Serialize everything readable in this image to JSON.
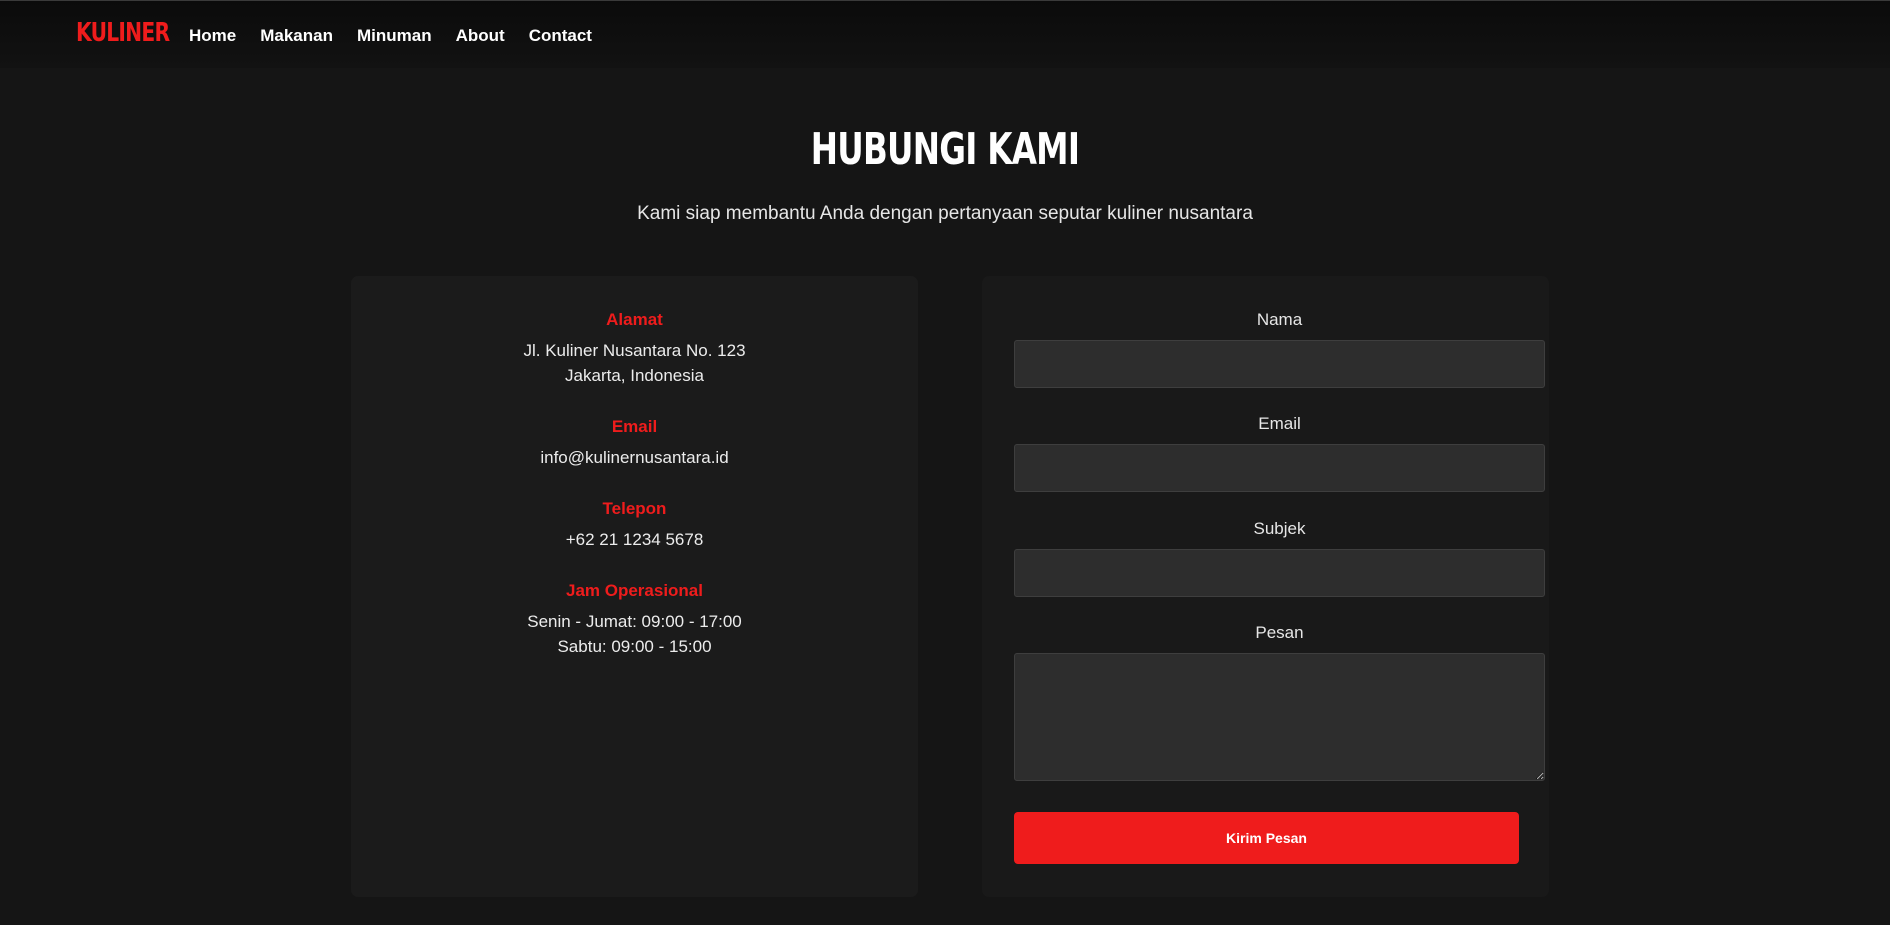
{
  "brand": {
    "logo": "KULINER",
    "accent_color": "#ef1c1c"
  },
  "nav": {
    "items": [
      "Home",
      "Makanan",
      "Minuman",
      "About",
      "Contact"
    ]
  },
  "header": {
    "title": "HUBUNGI KAMI",
    "subtitle": "Kami siap membantu Anda dengan pertanyaan seputar kuliner nusantara"
  },
  "contact_info": {
    "address": {
      "label": "Alamat",
      "line1": "Jl. Kuliner Nusantara No. 123",
      "line2": "Jakarta, Indonesia"
    },
    "email": {
      "label": "Email",
      "value": "info@kulinernusantara.id"
    },
    "phone": {
      "label": "Telepon",
      "value": "+62 21 1234 5678"
    },
    "hours": {
      "label": "Jam Operasional",
      "line1": "Senin - Jumat: 09:00 - 17:00",
      "line2": "Sabtu: 09:00 - 15:00"
    }
  },
  "form": {
    "name_label": "Nama",
    "name_value": "",
    "email_label": "Email",
    "email_value": "",
    "subject_label": "Subjek",
    "subject_value": "",
    "message_label": "Pesan",
    "message_value": "",
    "submit_label": "Kirim Pesan"
  }
}
